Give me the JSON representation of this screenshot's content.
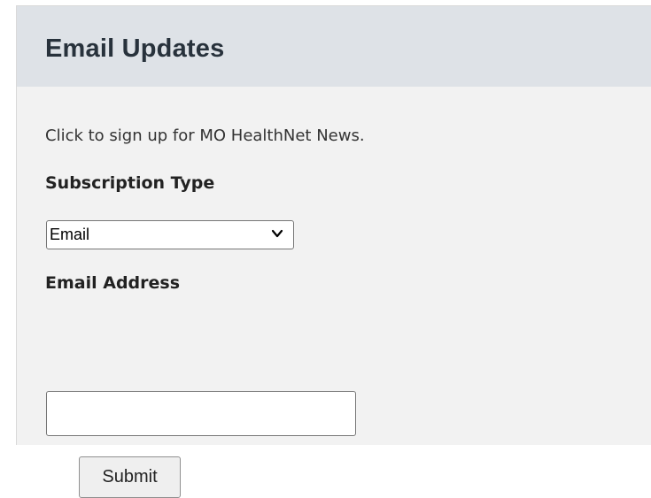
{
  "widget": {
    "title": "Email Updates",
    "intro_text": "Click to sign up for MO HealthNet News.",
    "subscription_type": {
      "label": "Subscription Type",
      "selected": "Email"
    },
    "email_address": {
      "label": "Email Address",
      "value": "",
      "placeholder": ""
    },
    "submit_label": "Submit"
  },
  "colors": {
    "panel_background": "#f2f2f2",
    "header_background": "#dee2e7",
    "title_text": "#28323c"
  },
  "icons": {
    "dropdown": "chevron-down-icon"
  }
}
